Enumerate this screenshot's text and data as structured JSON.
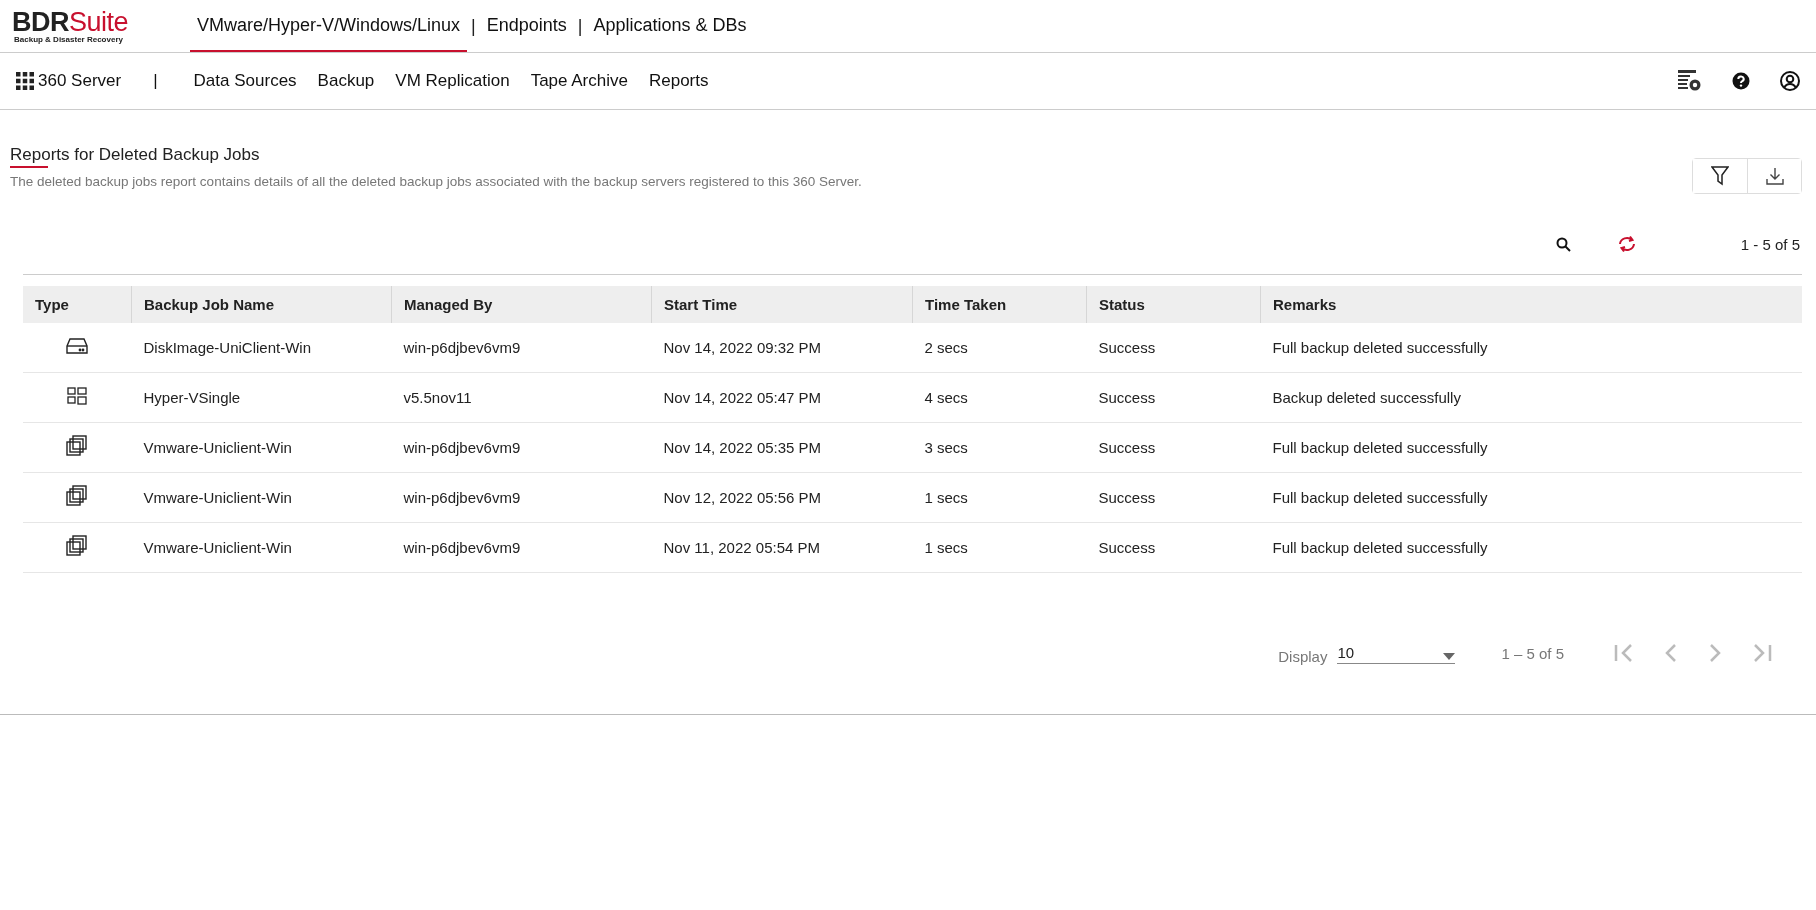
{
  "logo": {
    "brand_dark": "BDR",
    "brand_red": "Suite",
    "tagline": "Backup & Disaster Recovery"
  },
  "top_tabs": [
    {
      "label": "VMware/Hyper-V/Windows/Linux",
      "selected": true
    },
    {
      "label": "Endpoints",
      "selected": false
    },
    {
      "label": "Applications & DBs",
      "selected": false
    }
  ],
  "top_tab_separator": "|",
  "nav": {
    "home": "360 Server",
    "separator": "|",
    "items": [
      {
        "label": "Data Sources"
      },
      {
        "label": "Backup"
      },
      {
        "label": "VM Replication"
      },
      {
        "label": "Tape Archive"
      },
      {
        "label": "Reports"
      }
    ]
  },
  "page": {
    "title": "Reports for Deleted Backup Jobs",
    "description": "The deleted backup jobs report contains details of all the deleted backup jobs associated with the backup servers registered to this 360 Server."
  },
  "range_top": "1 - 5 of 5",
  "table": {
    "columns": [
      "Type",
      "Backup Job Name",
      "Managed By",
      "Start Time",
      "Time Taken",
      "Status",
      "Remarks"
    ],
    "rows": [
      {
        "kind": "disk",
        "name": "DiskImage-UniClient-Win",
        "managed_by": "win-p6djbev6vm9",
        "start": "Nov 14, 2022 09:32 PM",
        "taken": "2 secs",
        "status": "Success",
        "remarks": "Full backup deleted successfully"
      },
      {
        "kind": "hyperv",
        "name": "Hyper-VSingle",
        "managed_by": "v5.5nov11",
        "start": "Nov 14, 2022 05:47 PM",
        "taken": "4 secs",
        "status": "Success",
        "remarks": "Backup deleted successfully"
      },
      {
        "kind": "vmware",
        "name": "Vmware-Uniclient-Win",
        "managed_by": "win-p6djbev6vm9",
        "start": "Nov 14, 2022 05:35 PM",
        "taken": "3 secs",
        "status": "Success",
        "remarks": "Full backup deleted successfully"
      },
      {
        "kind": "vmware",
        "name": "Vmware-Uniclient-Win",
        "managed_by": "win-p6djbev6vm9",
        "start": "Nov 12, 2022 05:56 PM",
        "taken": "1 secs",
        "status": "Success",
        "remarks": "Full backup deleted successfully"
      },
      {
        "kind": "vmware",
        "name": "Vmware-Uniclient-Win",
        "managed_by": "win-p6djbev6vm9",
        "start": "Nov 11, 2022 05:54 PM",
        "taken": "1 secs",
        "status": "Success",
        "remarks": "Full backup deleted successfully"
      }
    ]
  },
  "pagination": {
    "display_label": "Display",
    "page_size": "10",
    "range": "1 – 5 of 5"
  }
}
